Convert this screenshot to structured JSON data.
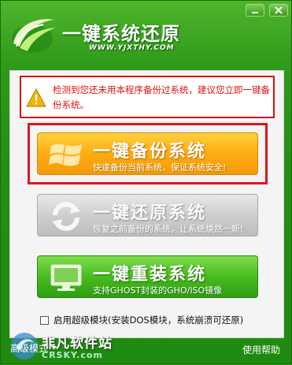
{
  "app": {
    "title": "一键系统还原",
    "url": "WWW.YJXTHY.COM"
  },
  "window_controls": {
    "minimize_icon": "minimize-icon",
    "close_icon": "close-icon"
  },
  "warning": {
    "text": "检测到您还未用本程序备份过系统，建议您立即一键备份系统。"
  },
  "buttons": {
    "backup": {
      "title": "一键备份系统",
      "subtitle": "快速备份当前系统，保证系统安全!"
    },
    "restore": {
      "title": "一键还原系统",
      "subtitle": "恢复之前备份的系统，让系统焕然一新!"
    },
    "reinstall": {
      "title": "一键重装系统",
      "subtitle": "支持GHOST封装的GHO/ISO镜像"
    }
  },
  "advanced": {
    "checked": false,
    "label": "启用超级模块(安装DOS模块，系统崩溃可还原)"
  },
  "footer": {
    "mode_label": "高级模式",
    "help_label": "使用帮助"
  },
  "watermark": {
    "brand": "非凡软件站",
    "site": "CRSKY.com"
  },
  "colors": {
    "frame_green": "#239012",
    "warning_red": "#e01010",
    "backup_orange": "#ffae14",
    "restore_gray": "#cfcfcf",
    "reinstall_green": "#49bc1e"
  }
}
